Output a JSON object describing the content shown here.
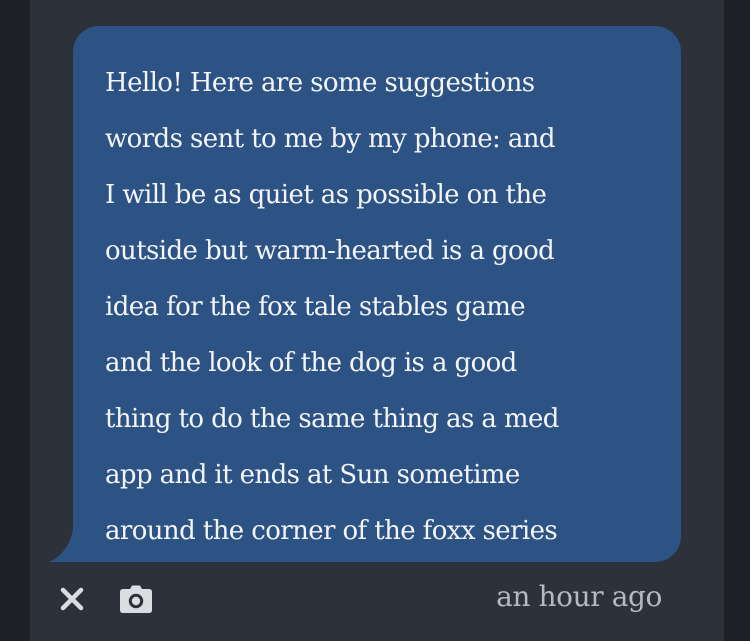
{
  "message": {
    "text": "Hello! Here are some suggestions\nwords sent to me by my phone: and\nI will be as quiet as possible on the\noutside but warm-hearted is a good\nidea for the fox tale stables game\nand the look of the dog is a good\nthing to do the same thing as a med\napp and it ends at Sun sometime\naround the corner of the foxx series",
    "bubble_color": "#2c5384",
    "text_color": "#f3f5f8"
  },
  "footer": {
    "timestamp": "an hour ago",
    "icons": [
      "close-icon",
      "camera-icon"
    ]
  },
  "colors": {
    "background": "#1d2026",
    "panel": "#2d3139",
    "icon": "#d9dce1",
    "muted_text": "#b4b9c2"
  }
}
